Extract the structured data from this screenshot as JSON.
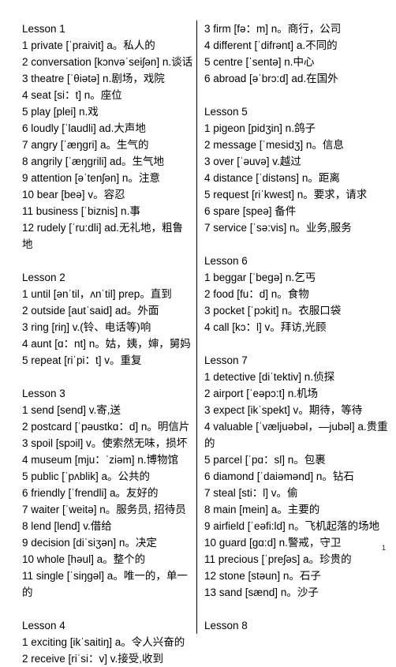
{
  "document": {
    "page_number": "1",
    "columns": [
      {
        "id": "left",
        "blocks": [
          {
            "title": "Lesson 1",
            "entries": [
              "1 private  [ˈpraivit] a。私人的",
              "2 conversation [kɔnvəˈseiʃən]  n.谈话",
              "3 theatre  [ˈθiətə]  n.剧场，戏院",
              "4 seat  [si：t]  n。座位",
              "5 play  [plei]  n.戏",
              "6 loudly  [ˈlaudli]  ad.大声地",
              "7 angry  [ˈæŋgri]  a。生气的",
              "8 angrily  [ˈæŋgrili]  ad。生气地",
              "9 attention  [əˈtenʃən] n。注意",
              "10 bear  [beə] v。容忍",
              "11 business  [ˈbiznis]  n.事",
              "12 rudely  [ˈru:dli]  ad.无礼地，粗鲁地"
            ]
          },
          {
            "title": "Lesson 2",
            "entries": [
              "1 until  [ənˈtil，ʌnˈtil]  prep。直到",
              "2 outside  [autˈsaid] ad。外面",
              "3 ring  [riŋ]  v.(铃、电话等)响",
              "4 aunt [ɑ：nt] n。姑，姨，婶，舅妈",
              "5 repeat  [riˈpi：t] v。重复"
            ]
          },
          {
            "title": "Lesson 3",
            "entries": [
              "1 send [send]  v.寄,送",
              "2 postcard [ˈpəustkɑ：d] n。明信片",
              "3 spoil [spɔil]  v。使索然无味，损坏",
              "4 museum  [mju：ˈziəm]  n.博物馆",
              "5 public [ˈpʌblik]  a。公共的",
              "6 friendly  [ˈfrendli]  a。友好的",
              "7 waiter [ˈweitə]  n。服务员, 招待员",
              "8 lend [lend] v.借给",
              "9 decision  [diˈsiʒən]  n。决定",
              "10 whole  [həul]  a。整个的",
              "11 single  [ˈsiŋgəl]  a。唯一的，单一的"
            ]
          },
          {
            "title": "Lesson 4",
            "entries": [
              "1 exciting [ikˈsaitiŋ]  a。令人兴奋的",
              "2 receive  [riˈsi：v] v.接受,收到"
            ]
          }
        ]
      },
      {
        "id": "right",
        "blocks": [
          {
            "title": "",
            "entries": [
              "3 firm [fə：m]  n。商行，公司",
              "4 different  [ˈdifrənt]  a.不同的",
              "5 centre  [ˈsentə] n.中心",
              "6 abroad [əˈbrɔ:d] ad.在国外"
            ]
          },
          {
            "title": "Lesson 5",
            "entries": [
              "1 pigeon  [pidʒin]  n.鸽子",
              "2 message [ˈmesidʒ] n。信息",
              "3 over  [ˈəuvə] v.越过",
              "4 distance  [ˈdistəns]  n。距离",
              "5 request  [riˈkwest] n。要求，请求",
              "6 spare  [speə]  备件",
              "7 service  [ˈsə:vis]  n。业务,服务"
            ]
          },
          {
            "title": "Lesson 6",
            "entries": [
              "1 beggar  [ˈbegə]  n.乞丐",
              "2 food  [fu：d] n。食物",
              "3 pocket [ˈpɔkit]  n。衣服口袋",
              "4 call  [kɔ：l]  v。拜访,光顾"
            ]
          },
          {
            "title": "Lesson 7",
            "entries": [
              "1 detective  [diˈtektiv] n.侦探",
              "2 airport [ˈeəpɔ:t] n.机场",
              "3 expect [ikˈspekt]  v。期待，等待",
              "4 valuable [ˈvæljuəbəl，—jubəl]  a.贵重的",
              "5 parcel  [ˈpɑ：sl] n。包裹",
              "6 diamond  [ˈdaiəmənd]  n。钻石",
              "7 steal [sti：l]  v。偷",
              "8 main  [mein]  a。主要的",
              "9 airfield [ˈeəfi:ld]  n。飞机起落的场地",
              "10 guard  [gɑ:d]  n.警戒，守卫",
              "11 precious  [ˈpreʃəs]  a。珍贵的",
              "12 stone [stəun] n。石子",
              "13 sand  [sænd] n。沙子"
            ]
          },
          {
            "title": "Lesson 8",
            "entries": []
          }
        ]
      }
    ]
  }
}
